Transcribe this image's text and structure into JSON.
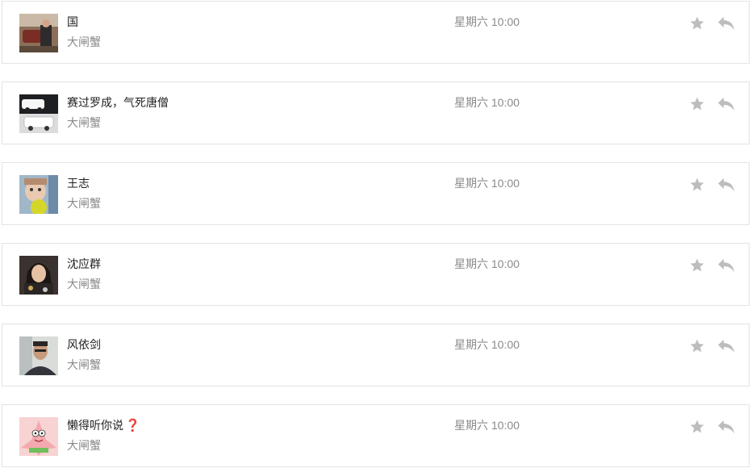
{
  "messages": [
    {
      "name": "国",
      "sub": "大闸蟹",
      "time": "星期六 10:00",
      "avatar": "avatar-car-photo",
      "has_question": false
    },
    {
      "name": "赛过罗成，气死唐僧",
      "sub": "大闸蟹",
      "time": "星期六 10:00",
      "avatar": "avatar-white-cars",
      "has_question": false
    },
    {
      "name": "王志",
      "sub": "大闸蟹",
      "time": "星期六 10:00",
      "avatar": "avatar-child-photo",
      "has_question": false
    },
    {
      "name": "沈应群",
      "sub": "大闸蟹",
      "time": "星期六 10:00",
      "avatar": "avatar-woman-photo",
      "has_question": false
    },
    {
      "name": "风依剑",
      "sub": "大闸蟹",
      "time": "星期六 10:00",
      "avatar": "avatar-man-photo",
      "has_question": false
    },
    {
      "name": "懒得听你说",
      "sub": "大闸蟹",
      "time": "星期六 10:00",
      "avatar": "avatar-patrick-star",
      "has_question": true,
      "question_mark": "❓"
    }
  ],
  "icons": {
    "star": "star-icon",
    "reply": "reply-icon"
  },
  "colors": {
    "icon_gray": "#bdbdbd",
    "border": "#e3e3e3",
    "muted_text": "#8a8a8a",
    "name_text": "#222222",
    "question": "#c9312b"
  }
}
